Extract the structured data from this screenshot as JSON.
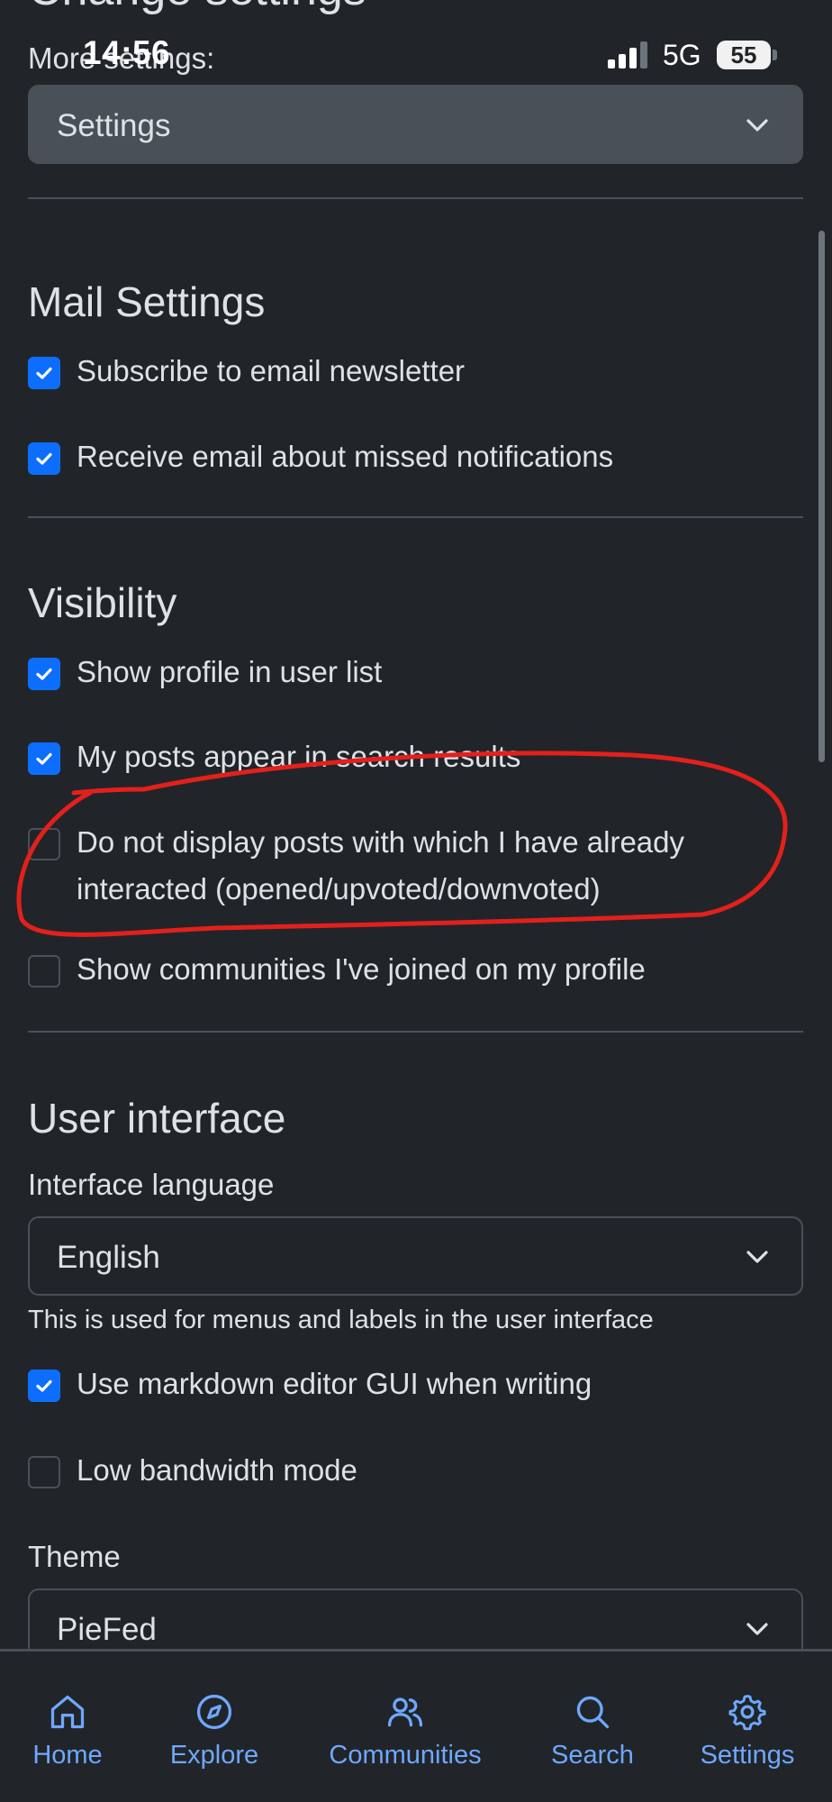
{
  "header": {
    "heading_partial": "Change settings",
    "more_settings_label": "More settings:",
    "settings_select_value": "Settings"
  },
  "status_bar": {
    "time": "14:56",
    "network": "5G",
    "battery": "55"
  },
  "mail_settings": {
    "title": "Mail Settings",
    "items": [
      {
        "label": "Subscribe to email newsletter",
        "checked": true
      },
      {
        "label": "Receive email about missed notifications",
        "checked": true
      }
    ]
  },
  "visibility": {
    "title": "Visibility",
    "items": [
      {
        "label": "Show profile in user list",
        "checked": true
      },
      {
        "label": "My posts appear in search results",
        "checked": true
      },
      {
        "label": "Do not display posts with which I have already interacted (opened/upvoted/downvoted)",
        "checked": false
      },
      {
        "label": "Show communities I've joined on my profile",
        "checked": false
      }
    ]
  },
  "user_interface": {
    "title": "User interface",
    "language_label": "Interface language",
    "language_value": "English",
    "language_help": "This is used for menus and labels in the user interface",
    "items": [
      {
        "label": "Use markdown editor GUI when writing",
        "checked": true
      },
      {
        "label": "Low bandwidth mode",
        "checked": false
      }
    ],
    "theme_label": "Theme",
    "theme_value": "PieFed"
  },
  "bottom_nav": {
    "items": [
      {
        "label": "Home",
        "icon": "home-icon"
      },
      {
        "label": "Explore",
        "icon": "compass-icon"
      },
      {
        "label": "Communities",
        "icon": "users-icon"
      },
      {
        "label": "Search",
        "icon": "search-icon"
      },
      {
        "label": "Settings",
        "icon": "gear-icon"
      }
    ]
  },
  "colors": {
    "background": "#212529",
    "accent": "#0d6efd",
    "nav_accent": "#6ea8fe",
    "annotation": "#e3201b"
  }
}
